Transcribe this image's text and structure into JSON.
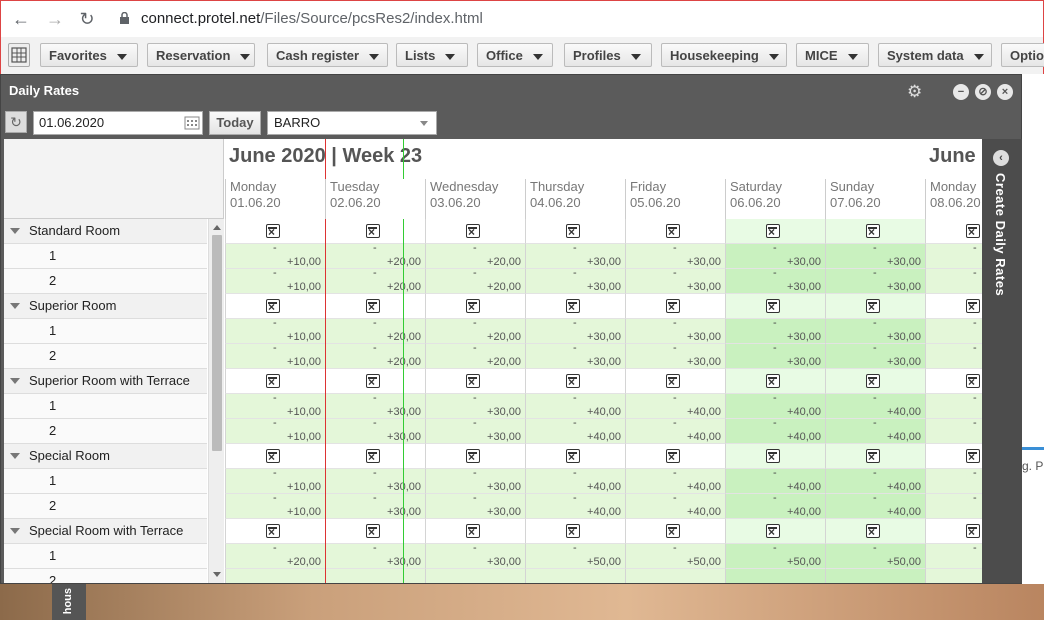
{
  "browser": {
    "back_icon": "←",
    "forward_icon": "→",
    "reload_icon": "↻",
    "url_host": "connect.protel.net",
    "url_path": "/Files/Source/pcsRes2/index.html"
  },
  "menubar": {
    "items": [
      {
        "label": "Favorites"
      },
      {
        "label": "Reservation"
      },
      {
        "label": "Cash register"
      },
      {
        "label": "Lists"
      },
      {
        "label": "Office"
      },
      {
        "label": "Profiles"
      },
      {
        "label": "Housekeeping"
      },
      {
        "label": "MICE"
      },
      {
        "label": "System data"
      },
      {
        "label": "Optio"
      }
    ]
  },
  "window": {
    "title": "Daily Rates",
    "date_value": "01.06.2020",
    "today_label": "Today",
    "rate_code": "BARRO"
  },
  "calendar": {
    "month_title": "June 2020 | Week 23",
    "month_title_next": "June",
    "days": [
      {
        "name": "Monday",
        "date": "01.06.20",
        "weekend": false
      },
      {
        "name": "Tuesday",
        "date": "02.06.20",
        "weekend": false
      },
      {
        "name": "Wednesday",
        "date": "03.06.20",
        "weekend": false
      },
      {
        "name": "Thursday",
        "date": "04.06.20",
        "weekend": false
      },
      {
        "name": "Friday",
        "date": "05.06.20",
        "weekend": false
      },
      {
        "name": "Saturday",
        "date": "06.06.20",
        "weekend": true
      },
      {
        "name": "Sunday",
        "date": "07.06.20",
        "weekend": true
      },
      {
        "name": "Monday",
        "date": "08.06.20",
        "weekend": false
      }
    ],
    "rows": [
      {
        "type": "cat",
        "label": "Standard Room"
      },
      {
        "type": "sub",
        "label": "1",
        "values": [
          "+10,00",
          "+20,00",
          "+20,00",
          "+30,00",
          "+30,00",
          "+30,00",
          "+30,00",
          "-"
        ]
      },
      {
        "type": "sub",
        "label": "2",
        "values": [
          "+10,00",
          "+20,00",
          "+20,00",
          "+30,00",
          "+30,00",
          "+30,00",
          "+30,00",
          "-"
        ]
      },
      {
        "type": "cat",
        "label": "Superior Room"
      },
      {
        "type": "sub",
        "label": "1",
        "values": [
          "+10,00",
          "+20,00",
          "+20,00",
          "+30,00",
          "+30,00",
          "+30,00",
          "+30,00",
          "-"
        ]
      },
      {
        "type": "sub",
        "label": "2",
        "values": [
          "+10,00",
          "+20,00",
          "+20,00",
          "+30,00",
          "+30,00",
          "+30,00",
          "+30,00",
          "-"
        ]
      },
      {
        "type": "cat",
        "label": "Superior Room with Terrace"
      },
      {
        "type": "sub",
        "label": "1",
        "values": [
          "+10,00",
          "+30,00",
          "+30,00",
          "+40,00",
          "+40,00",
          "+40,00",
          "+40,00",
          "-"
        ]
      },
      {
        "type": "sub",
        "label": "2",
        "values": [
          "+10,00",
          "+30,00",
          "+30,00",
          "+40,00",
          "+40,00",
          "+40,00",
          "+40,00",
          "-"
        ]
      },
      {
        "type": "cat",
        "label": "Special Room"
      },
      {
        "type": "sub",
        "label": "1",
        "values": [
          "+10,00",
          "+30,00",
          "+30,00",
          "+40,00",
          "+40,00",
          "+40,00",
          "+40,00",
          "-"
        ]
      },
      {
        "type": "sub",
        "label": "2",
        "values": [
          "+10,00",
          "+30,00",
          "+30,00",
          "+40,00",
          "+40,00",
          "+40,00",
          "+40,00",
          "-"
        ]
      },
      {
        "type": "cat",
        "label": "Special Room with Terrace"
      },
      {
        "type": "sub",
        "label": "1",
        "values": [
          "+20,00",
          "+30,00",
          "+30,00",
          "+50,00",
          "+50,00",
          "+50,00",
          "+50,00",
          "-"
        ]
      },
      {
        "type": "sub",
        "label": "2",
        "values": [
          "",
          "",
          "",
          "",
          "",
          "",
          "",
          ""
        ]
      }
    ]
  },
  "right_panel": {
    "label": "Create Daily Rates"
  },
  "background": {
    "side_text": "g. P",
    "bottom_tab": "hous"
  }
}
